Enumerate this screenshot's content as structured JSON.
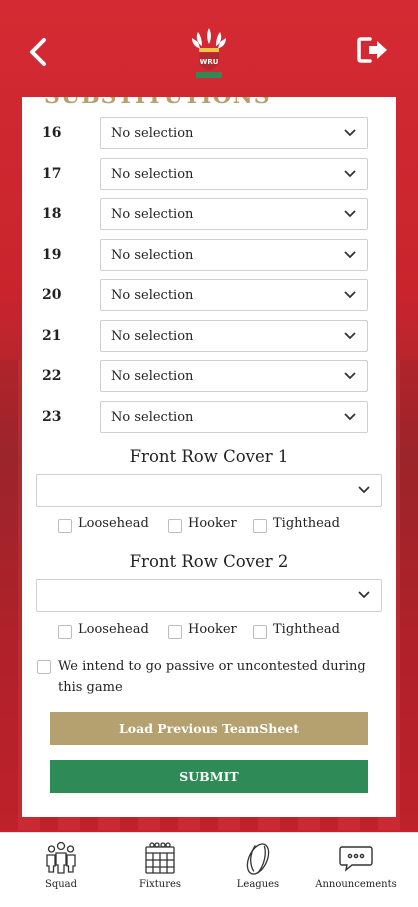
{
  "header": {
    "back_icon": "chevron-left-icon",
    "logout_icon": "logout-icon",
    "crest_text": "WRU"
  },
  "colors": {
    "brand_red": "#d42a33",
    "gold": "#b5a16f",
    "green": "#2e8b57"
  },
  "substitutions": {
    "title": "SUBSTITUTIONS",
    "rows": [
      {
        "number": "16",
        "value": "No selection"
      },
      {
        "number": "17",
        "value": "No selection"
      },
      {
        "number": "18",
        "value": "No selection"
      },
      {
        "number": "19",
        "value": "No selection"
      },
      {
        "number": "20",
        "value": "No selection"
      },
      {
        "number": "21",
        "value": "No selection"
      },
      {
        "number": "22",
        "value": "No selection"
      },
      {
        "number": "23",
        "value": "No selection"
      }
    ]
  },
  "front_row_cover_1": {
    "title": "Front Row Cover 1",
    "value": "",
    "options": [
      "Loosehead",
      "Hooker",
      "Tighthead"
    ]
  },
  "front_row_cover_2": {
    "title": "Front Row Cover 2",
    "value": "",
    "options": [
      "Loosehead",
      "Hooker",
      "Tighthead"
    ]
  },
  "passive": {
    "label": "We intend to go passive or uncontested during this game"
  },
  "buttons": {
    "load_previous": "Load Previous TeamSheet",
    "submit": "SUBMIT"
  },
  "tabbar": {
    "items": [
      {
        "label": "Squad",
        "icon": "squad-icon"
      },
      {
        "label": "Fixtures",
        "icon": "calendar-icon"
      },
      {
        "label": "Leagues",
        "icon": "rugby-ball-icon"
      },
      {
        "label": "Announcements",
        "icon": "chat-bubble-icon"
      }
    ]
  }
}
